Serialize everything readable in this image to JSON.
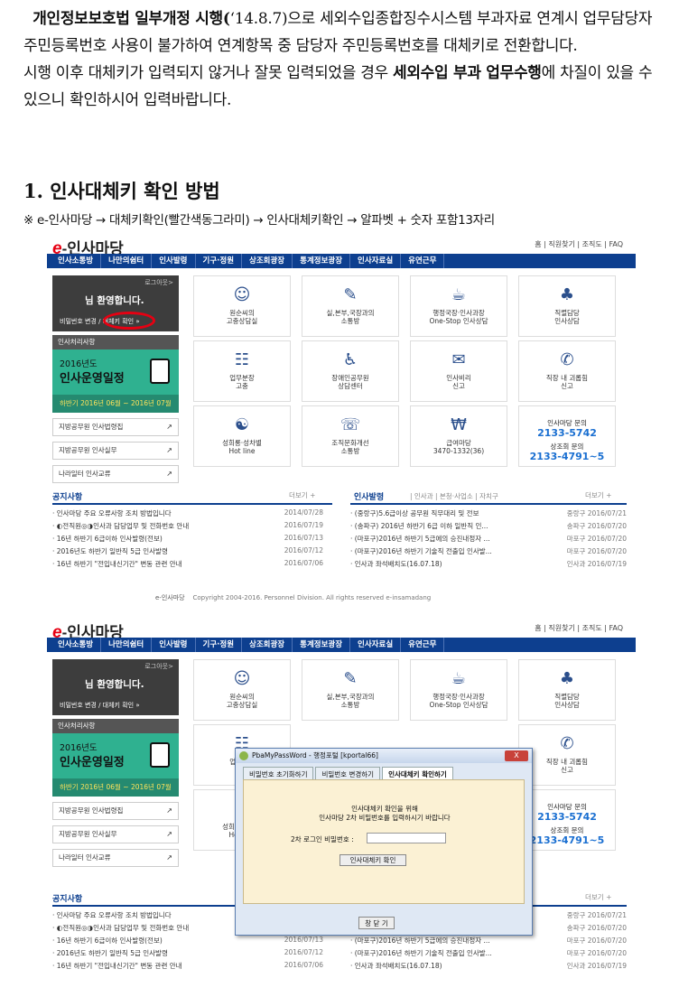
{
  "intro": {
    "p1_bold": "개인정보보호법 일부개정 시행(",
    "p1_date": "‘14.8.7)",
    "p1_rest": "으로 세외수입종합징수시스템 부과자료 연계시 업무담당자 주민등록번호 사용이 불가하여 연계항목 중 담당자 주민등록번호를 대체키로 전환합니다.",
    "p2_a": " 시행 이후 대체키가 입력되지 않거나 잘못 입력되었을 경우 ",
    "p2_bold": "세외수입 부과 업무수행",
    "p2_b": "에 차질이 있을 수 있으니 확인하시어 입력바랍니다."
  },
  "heading": "1. 인사대체키 확인 방법",
  "note": "※ e-인사마당 → 대체키확인(빨간색동그라미) → 인사대체키확인 → 알파벳 + 숫자 포함13자리",
  "site": {
    "logo_e": "e",
    "logo_text": "-인사마당",
    "toplinks": "홈 | 직원찾기 | 조직도 | FAQ",
    "nav": [
      "인사소통방",
      "나만의쉼터",
      "인사발령",
      "기구·정원",
      "상조회광장",
      "통계정보광장",
      "인사자료실",
      "유연근무"
    ],
    "login_label": "로그아웃>",
    "welcome": "님 환영합니다.",
    "login_links": "비밀번호 변경 / 대체키 확인  »",
    "hr_title": "인사처리사항",
    "hr_year": "2016년도",
    "hr_big": "인사운영일정",
    "hr_dates": "하반기  2016년 06월 ~ 2016년 07월",
    "links": [
      "지방공무원 인사법령집",
      "지방공무원 인사실무",
      "나라일터 인사교류"
    ],
    "tiles": [
      {
        "l1": "원순씨의",
        "l2": "고충상담실",
        "icon": "☺"
      },
      {
        "l1": "실,본부,국장과의",
        "l2": "소통방",
        "icon": "✎"
      },
      {
        "l1": "행정국장·인사과장",
        "l2": "One-Stop 인사상담",
        "icon": "☕"
      },
      {
        "l1": "직렬담당",
        "l2": "인사상담",
        "icon": "♣"
      },
      {
        "l1": "업무분장",
        "l2": "고충",
        "icon": "☷"
      },
      {
        "l1": "장애인공무원",
        "l2": "상담센터",
        "icon": "♿"
      },
      {
        "l1": "인사비리",
        "l2": "신고",
        "icon": "✉"
      },
      {
        "l1": "직장 내 괴롭힘",
        "l2": "신고",
        "icon": "✆"
      },
      {
        "l1": "성희롱·성차별",
        "l2": "Hot line",
        "icon": "☯"
      },
      {
        "l1": "조직문화개선",
        "l2": "소통방",
        "icon": "☏"
      },
      {
        "l1": "급여마당",
        "l2": "3470-1332(36)",
        "icon": "₩"
      }
    ],
    "contact": {
      "a": "인사마당 문의",
      "b": "2133-5742",
      "c": "상조회 문의",
      "d": "2133-4791~5"
    },
    "notice_title": "공지사항",
    "more": "더보기  +",
    "notices": [
      {
        "t": "· 인사마당 주요 오류사항 조치 방법입니다",
        "d": "2014/07/28"
      },
      {
        "t": "· ◐전직원◎◑인사과 담당업무 및 전화번호 안내",
        "d": "2016/07/19"
      },
      {
        "t": "· 16년 하반기 6급이하 인사발령(전보)",
        "d": "2016/07/13"
      },
      {
        "t": "· 2016년도 하반기 일반직 5급 인사발령",
        "d": "2016/07/12"
      },
      {
        "t": "· 16년 하반기 \"전입내신기간\" 변동 관련 안내",
        "d": "2016/07/06"
      }
    ],
    "posting_title": "인사발령",
    "posting_tabs": "|  인사과   |   본청·사업소   |   자치구",
    "postings": [
      {
        "t": "· (중랑구)5.6급이상 공무원 직무대리 및 전보",
        "d": "중랑구 2016/07/21"
      },
      {
        "t": "· (송파구) 2016년 하반기 6급 이하 일반직 인...",
        "d": "송파구 2016/07/20"
      },
      {
        "t": "· (마포구)2016년 하반기 5급에의 승진내정자 ...",
        "d": "마포구 2016/07/20"
      },
      {
        "t": "· (마포구)2016년 하반기 기술직 전출입 인사발...",
        "d": "마포구 2016/07/20"
      },
      {
        "t": "· 인사과 좌석배치도(16.07.18)",
        "d": "인사과 2016/07/19"
      }
    ],
    "copyright_logo": "e-인사마당",
    "copyright": "Copyright 2004-2016. Personnel Division. All rights reserved e-insamadang"
  },
  "dialog": {
    "title": "PbaMyPassWord - 행정포털 [kportal66]",
    "close_x": "X",
    "tabs": [
      "비밀번호 초기화하기",
      "비밀번호 변경하기",
      "인사대체키 확인하기"
    ],
    "msg1": "인사대체키 확인을 위해",
    "msg2": "인사마당 2차 비밀번호를 입력하시기 바랍니다",
    "pw_label": "2차 로그인 비밀번호 :",
    "confirm": "인사대체키 확인",
    "close": "창 닫 기"
  }
}
